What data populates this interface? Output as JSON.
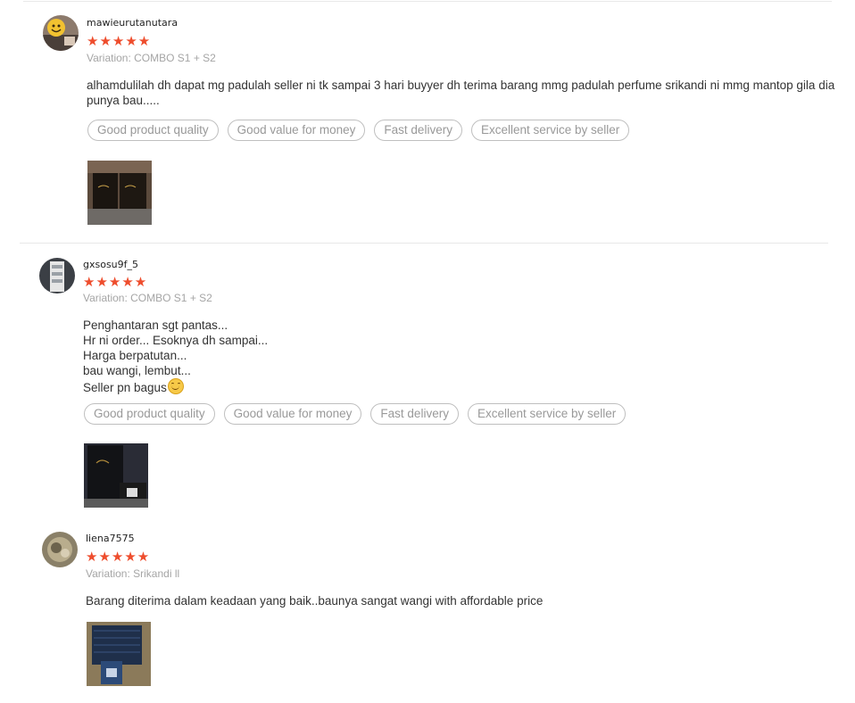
{
  "reviews": [
    {
      "username": "mawieurutanutara",
      "stars": "★★★★★",
      "variation": "Variation: COMBO S1 + S2",
      "comment": "alhamdulilah dh dapat  mg padulah seller ni tk sampai 3 hari buyyer dh terima barang mmg padulah perfume srikandi ni mmg mantop gila dia punya bau.....",
      "tags": [
        "Good product quality",
        "Good value for money",
        "Fast delivery",
        "Excellent service by seller"
      ]
    },
    {
      "username": "gxsosu9f_5",
      "stars": "★★★★★",
      "variation": "Variation: COMBO S1 + S2",
      "comment": "Penghantaran sgt pantas...\nHr ni order... Esoknya dh sampai...\nHarga berpatutan...\nbau wangi, lembut...\nSeller pn bagus",
      "tags": [
        "Good product quality",
        "Good value for money",
        "Fast delivery",
        "Excellent service by seller"
      ]
    },
    {
      "username": "liena7575",
      "stars": "★★★★★",
      "variation": "Variation: Srikandi ll",
      "comment": "Barang diterima dalam keadaan yang baik..baunya sangat wangi with affordable price",
      "tags": []
    }
  ],
  "colors": {
    "star": "#ee4d2d",
    "muted": "#a5a5a5",
    "tag_border": "#bfbfbf"
  },
  "icons": {
    "emoji": "smiling-face-icon"
  }
}
